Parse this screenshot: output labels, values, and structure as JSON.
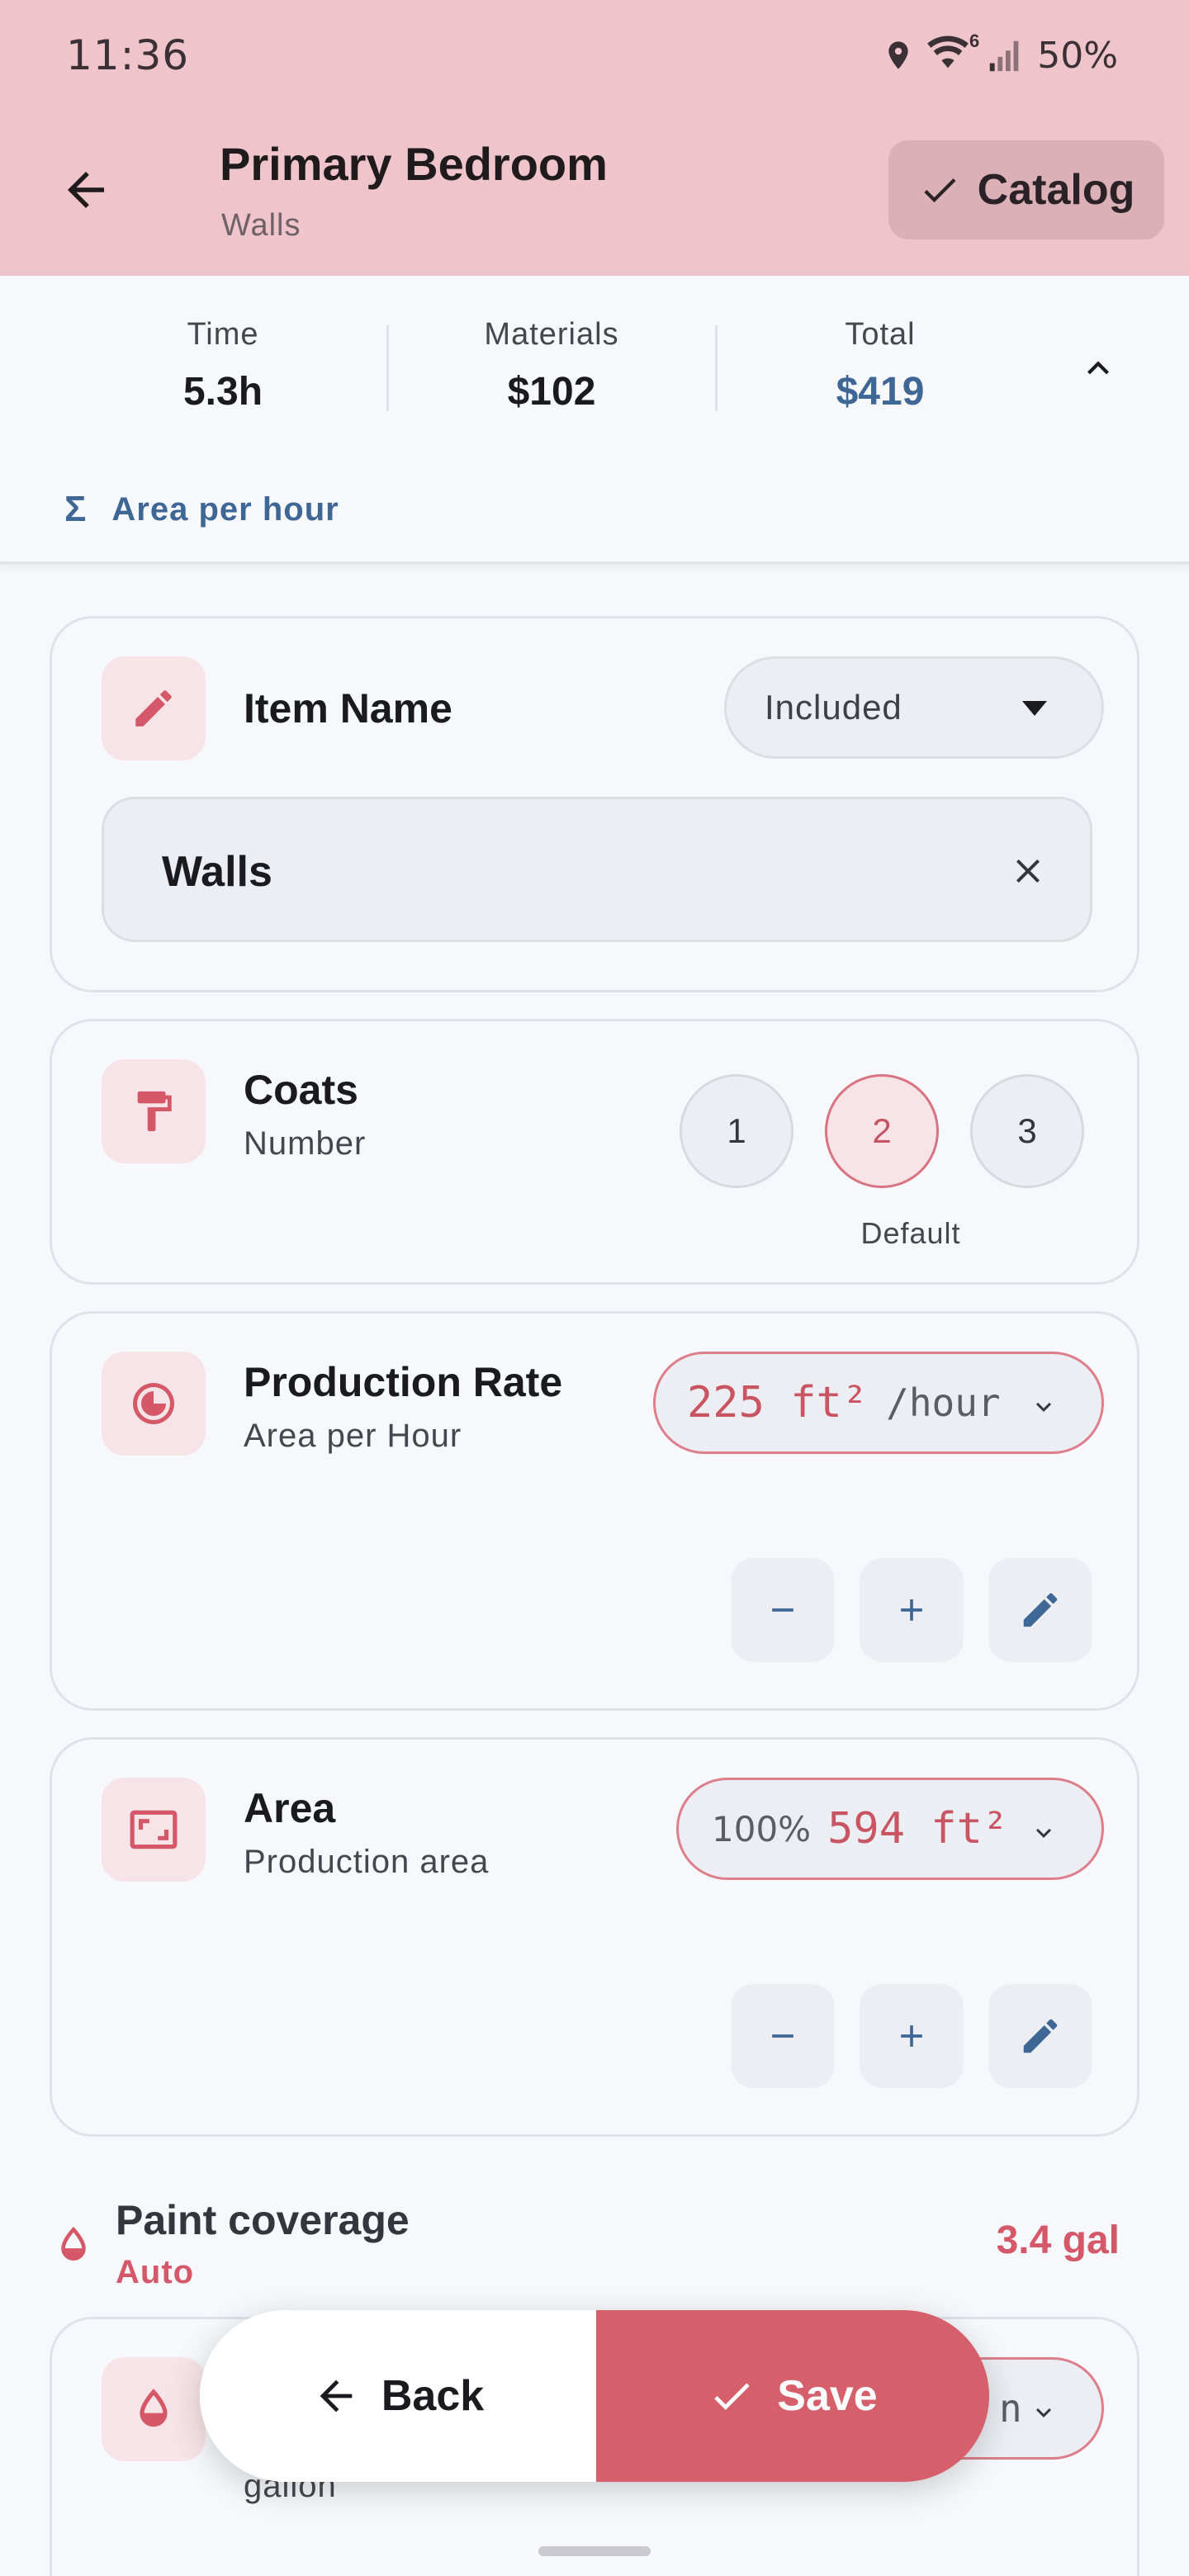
{
  "status_bar": {
    "time": "11:36",
    "battery": "50%",
    "wifi_badge": "6"
  },
  "header": {
    "title": "Primary Bedroom",
    "subtitle": "Walls",
    "catalog_label": "Catalog",
    "bg_color": "#efc4cb"
  },
  "summary": {
    "time_label": "Time",
    "time_value": "5.3h",
    "materials_label": "Materials",
    "materials_value": "$102",
    "total_label": "Total",
    "total_value": "$419",
    "formula_label": "Area per hour"
  },
  "item_name": {
    "label": "Item Name",
    "status_select": "Included",
    "value": "Walls"
  },
  "coats": {
    "title": "Coats",
    "subtitle": "Number",
    "options": [
      "1",
      "2",
      "3"
    ],
    "selected": "2",
    "default_label": "Default"
  },
  "production_rate": {
    "title": "Production Rate",
    "subtitle": "Area per Hour",
    "value": "225 ft²",
    "unit": "/hour"
  },
  "area": {
    "title": "Area",
    "subtitle": "Production area",
    "percent": "100%",
    "value": "594 ft²"
  },
  "paint_coverage": {
    "title": "Paint coverage",
    "subtitle": "Auto",
    "value": "3.4 gal",
    "partial_card_subtitle": "gallon",
    "partial_pill_suffix": "n"
  },
  "actions": {
    "back_label": "Back",
    "save_label": "Save"
  },
  "colors": {
    "accent": "#d5606c",
    "blue": "#3f6796"
  }
}
